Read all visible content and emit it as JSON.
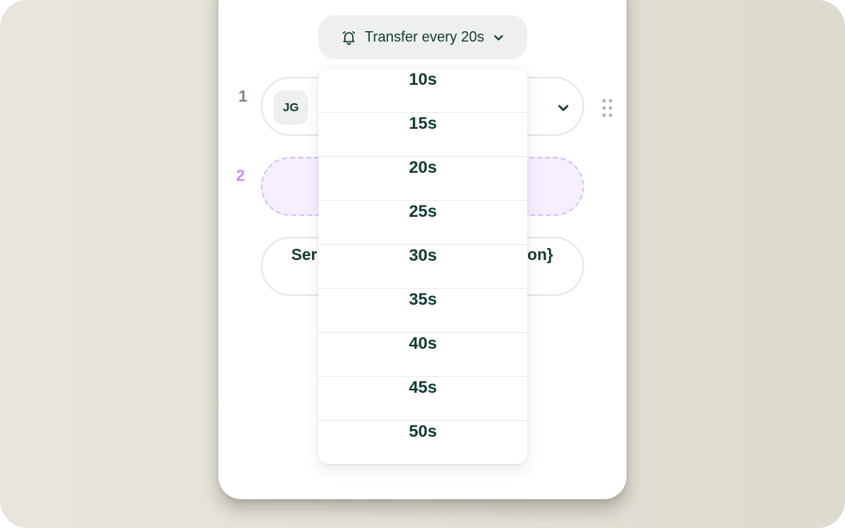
{
  "trigger": {
    "label": "Transfer every 20s",
    "icon": "bell-icon",
    "caret_icon": "chevron-down-icon"
  },
  "steps": [
    {
      "number": "1",
      "avatar": "JG",
      "color": "#7e8784"
    },
    {
      "number": "2",
      "color": "#c98ff0"
    }
  ],
  "row3": {
    "left_text": "Ser",
    "right_text": "on}"
  },
  "dropdown": {
    "options": [
      "10s",
      "15s",
      "20s",
      "25s",
      "30s",
      "35s",
      "40s",
      "45s",
      "50s"
    ]
  },
  "colors": {
    "text": "#123b33",
    "accent": "#c98ff0",
    "pill_bg": "#eef0ee"
  }
}
